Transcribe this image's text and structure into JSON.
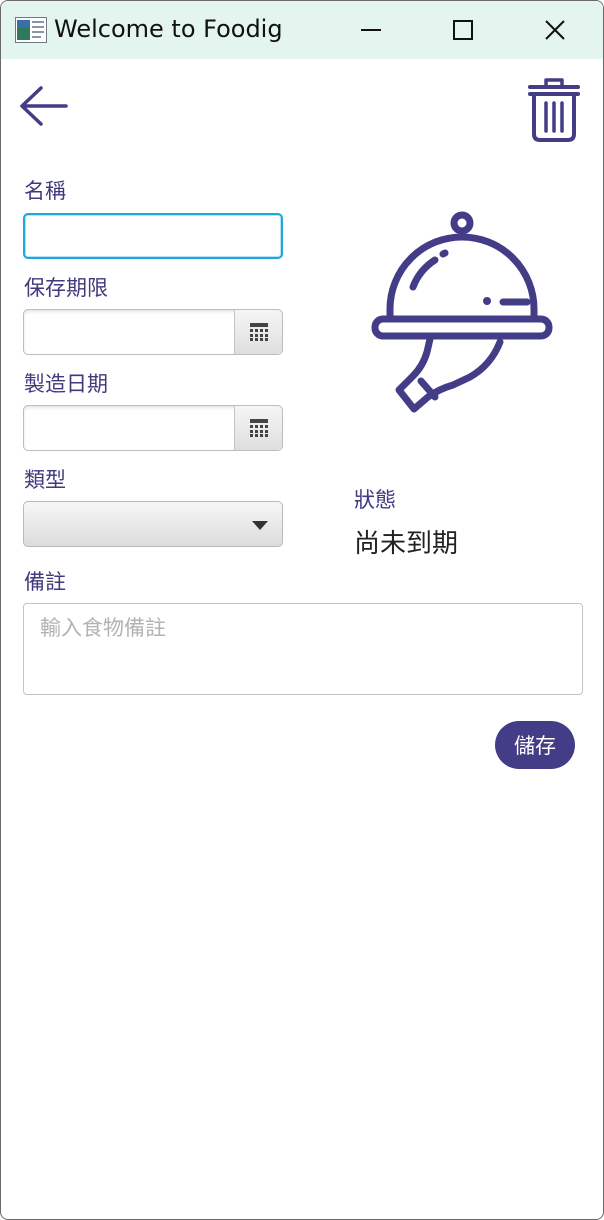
{
  "window": {
    "title": "Welcome to Foodig"
  },
  "form": {
    "name_label": "名稱",
    "name_value": "",
    "expiry_label": "保存期限",
    "expiry_value": "",
    "manufacture_label": "製造日期",
    "manufacture_value": "",
    "type_label": "類型",
    "type_value": "",
    "note_label": "備註",
    "note_placeholder": "輸入食物備註",
    "note_value": ""
  },
  "status": {
    "label": "狀態",
    "value": "尚未到期"
  },
  "actions": {
    "save_label": "儲存"
  },
  "icons": {
    "back": "arrow-left-icon",
    "delete": "trash-icon",
    "calendar": "calendar-icon",
    "dropdown": "chevron-down-icon",
    "illustration": "serving-cloche-icon"
  },
  "colors": {
    "accent": "#433c86",
    "titlebar": "#e4f5ef",
    "focus": "#1ea6df"
  }
}
